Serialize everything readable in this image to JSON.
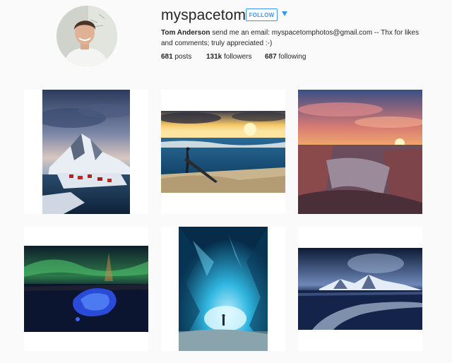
{
  "profile": {
    "username": "myspacetom",
    "follow_label": "FOLLOW",
    "bio_name": "Tom Anderson",
    "bio_text": " send me an email: myspacetomphotos@gmail.com -- Thx for likes and comments; truly appreciated :-)",
    "stats": [
      {
        "value": "681",
        "label": " posts"
      },
      {
        "value": "131k",
        "label": " followers"
      },
      {
        "value": "687",
        "label": " following"
      }
    ]
  },
  "grid": {
    "photos": [
      {
        "subject": "lofoten-mountain-village"
      },
      {
        "subject": "surfer-at-sunset"
      },
      {
        "subject": "canyon-sunset"
      },
      {
        "subject": "aurora-blue-rock"
      },
      {
        "subject": "ice-cave"
      },
      {
        "subject": "mountain-seascape"
      }
    ]
  },
  "colors": {
    "accent": "#3897f0",
    "background": "#fafafa",
    "text": "#262626"
  },
  "icons": {
    "dropdown": "caret-down-icon"
  }
}
